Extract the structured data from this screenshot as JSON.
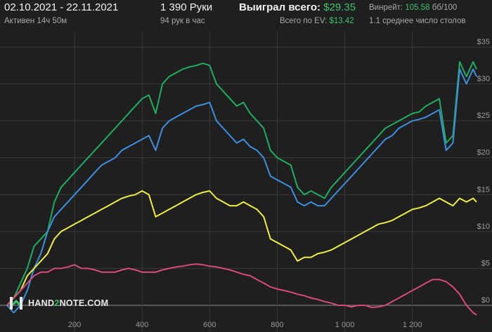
{
  "header": {
    "date_range": "02.10.2021 - 22.11.2021",
    "active": "Активен 14ч 50м",
    "hands": "1 390 Руки",
    "hands_per_hour": "94 рук в час",
    "won_label": "Выиграл всего:",
    "won_value": "$29.35",
    "ev_label": "Всего по EV:",
    "ev_value": "$13.42",
    "winrate_label": "Винрейт:",
    "winrate_value": "105.58",
    "winrate_unit": "бб/100",
    "tables": "1.1 среднее число столов"
  },
  "logo": {
    "prefix": "HAND",
    "mid": "2",
    "suffix": "NOTE.COM"
  },
  "colors": {
    "background": "#1f1f1f",
    "green": "#1fae5f",
    "blue": "#3d8fe0",
    "yellow": "#eeee44",
    "pink": "#d94a7c",
    "grid": "#3a3a3a",
    "zero": "#8c8c8c"
  },
  "chart_data": {
    "type": "line",
    "xlim": [
      0,
      1390
    ],
    "ylim": [
      -2,
      37
    ],
    "x_ticks": [
      200,
      400,
      600,
      800,
      1000,
      1200
    ],
    "x_tick_labels": [
      "200",
      "400",
      "600",
      "800",
      "1 000",
      "1 200"
    ],
    "y_ticks": [
      0,
      5,
      10,
      15,
      20,
      25,
      30,
      35
    ],
    "y_tick_labels": [
      "$0",
      "$5",
      "$10",
      "$15",
      "$20",
      "$25",
      "$30",
      "$35"
    ],
    "grid": true,
    "series": [
      {
        "color": "green",
        "x": [
          0,
          20,
          40,
          60,
          80,
          100,
          120,
          140,
          160,
          180,
          200,
          220,
          240,
          260,
          280,
          300,
          320,
          340,
          360,
          380,
          400,
          420,
          440,
          460,
          480,
          500,
          520,
          540,
          560,
          580,
          600,
          620,
          640,
          660,
          680,
          700,
          720,
          740,
          760,
          780,
          800,
          820,
          840,
          860,
          880,
          900,
          920,
          940,
          960,
          980,
          1000,
          1020,
          1040,
          1060,
          1080,
          1100,
          1120,
          1140,
          1160,
          1180,
          1200,
          1220,
          1240,
          1260,
          1280,
          1300,
          1320,
          1340,
          1360,
          1380,
          1390
        ],
        "y": [
          0,
          1,
          3,
          5,
          8,
          9,
          10,
          14,
          16,
          17,
          18,
          19,
          20,
          21,
          22,
          23,
          24,
          25,
          26,
          27,
          28,
          28.5,
          26,
          30,
          31,
          31.5,
          32,
          32.3,
          32.5,
          32.8,
          32.5,
          30,
          29,
          28,
          27,
          27.5,
          26,
          25,
          24,
          21,
          20,
          19.5,
          19,
          16,
          15,
          15.5,
          15,
          14.5,
          16,
          17,
          18,
          19,
          20,
          21,
          22,
          23,
          24,
          24.5,
          25,
          25.5,
          26,
          26.2,
          27,
          27.5,
          28,
          22,
          23,
          33,
          31,
          33,
          32
        ]
      },
      {
        "color": "blue",
        "x": [
          0,
          20,
          40,
          60,
          80,
          100,
          120,
          140,
          160,
          180,
          200,
          220,
          240,
          260,
          280,
          300,
          320,
          340,
          360,
          380,
          400,
          420,
          440,
          460,
          480,
          500,
          520,
          540,
          560,
          580,
          600,
          620,
          640,
          660,
          680,
          700,
          720,
          740,
          760,
          780,
          800,
          820,
          840,
          860,
          880,
          900,
          920,
          940,
          960,
          980,
          1000,
          1020,
          1040,
          1060,
          1080,
          1100,
          1120,
          1140,
          1160,
          1180,
          1200,
          1220,
          1240,
          1260,
          1280,
          1300,
          1320,
          1340,
          1360,
          1380,
          1390
        ],
        "y": [
          0,
          -1,
          0,
          2,
          5,
          7,
          10,
          12,
          13,
          14,
          15,
          16,
          17,
          18,
          19,
          19.5,
          20,
          21,
          21.5,
          22,
          22.5,
          23,
          21,
          24,
          25,
          25.5,
          26,
          26.5,
          27,
          27.2,
          27.5,
          25,
          24,
          23,
          22,
          22.5,
          21.5,
          21,
          20,
          17.5,
          17,
          16.5,
          16,
          14,
          13.5,
          14,
          13.5,
          13.5,
          14.5,
          15.5,
          16.5,
          17.5,
          18.5,
          19.5,
          20.5,
          21.5,
          22.5,
          23,
          24,
          24.5,
          25,
          25.2,
          25.5,
          26,
          26.5,
          21,
          22,
          32,
          30,
          32,
          31
        ]
      },
      {
        "color": "yellow",
        "x": [
          0,
          20,
          40,
          60,
          80,
          100,
          120,
          140,
          160,
          180,
          200,
          220,
          240,
          260,
          280,
          300,
          320,
          340,
          360,
          380,
          400,
          420,
          440,
          460,
          480,
          500,
          520,
          540,
          560,
          580,
          600,
          620,
          640,
          660,
          680,
          700,
          720,
          740,
          760,
          780,
          800,
          820,
          840,
          860,
          880,
          900,
          920,
          940,
          960,
          980,
          1000,
          1020,
          1040,
          1060,
          1080,
          1100,
          1120,
          1140,
          1160,
          1180,
          1200,
          1220,
          1240,
          1260,
          1280,
          1300,
          1320,
          1340,
          1360,
          1380,
          1390
        ],
        "y": [
          0,
          1,
          2,
          4,
          5,
          6,
          7,
          9,
          10,
          10.5,
          11,
          11.5,
          12,
          12.5,
          13,
          13.5,
          14,
          14.5,
          14.8,
          15,
          15.5,
          15,
          12,
          12.5,
          13,
          13.5,
          14,
          14.5,
          15,
          15.3,
          15.5,
          14.5,
          14,
          13.5,
          13.5,
          14,
          13.5,
          13,
          12,
          9,
          8.5,
          8,
          7.5,
          6,
          6.5,
          6.5,
          7,
          7.2,
          7.5,
          8,
          8.5,
          9,
          9.5,
          10,
          10.5,
          11,
          11.2,
          11.5,
          12,
          12.5,
          13,
          13.2,
          13.5,
          14,
          14.5,
          14,
          13.5,
          14.5,
          14,
          14.5,
          14
        ]
      },
      {
        "color": "pink",
        "x": [
          0,
          20,
          40,
          60,
          80,
          100,
          120,
          140,
          160,
          180,
          200,
          220,
          240,
          260,
          280,
          300,
          320,
          340,
          360,
          380,
          400,
          420,
          440,
          460,
          480,
          500,
          520,
          540,
          560,
          580,
          600,
          620,
          640,
          660,
          680,
          700,
          720,
          740,
          760,
          780,
          800,
          820,
          840,
          860,
          880,
          900,
          920,
          940,
          960,
          980,
          1000,
          1020,
          1040,
          1060,
          1080,
          1100,
          1120,
          1140,
          1160,
          1180,
          1200,
          1220,
          1240,
          1260,
          1280,
          1300,
          1320,
          1340,
          1360,
          1380,
          1390
        ],
        "y": [
          0,
          1,
          2,
          3,
          4,
          4.5,
          4.5,
          5,
          5,
          5.2,
          5.5,
          5,
          5,
          4.8,
          4.5,
          4.5,
          4.5,
          4.8,
          5,
          4.8,
          4.5,
          4.5,
          4.5,
          4.8,
          5,
          5.2,
          5.3,
          5.5,
          5.6,
          5.5,
          5.3,
          5.2,
          5,
          4.8,
          4.5,
          4.2,
          4,
          3.5,
          3,
          2.5,
          2.2,
          2,
          1.8,
          1.5,
          1.3,
          1,
          0.8,
          0.5,
          0.3,
          0,
          0,
          -0.2,
          0,
          0,
          -0.3,
          -0.2,
          0,
          0.5,
          1,
          1.5,
          2,
          2.5,
          3,
          3.5,
          3.5,
          3.2,
          2.5,
          1.5,
          0,
          -1,
          -1.3
        ]
      }
    ]
  }
}
